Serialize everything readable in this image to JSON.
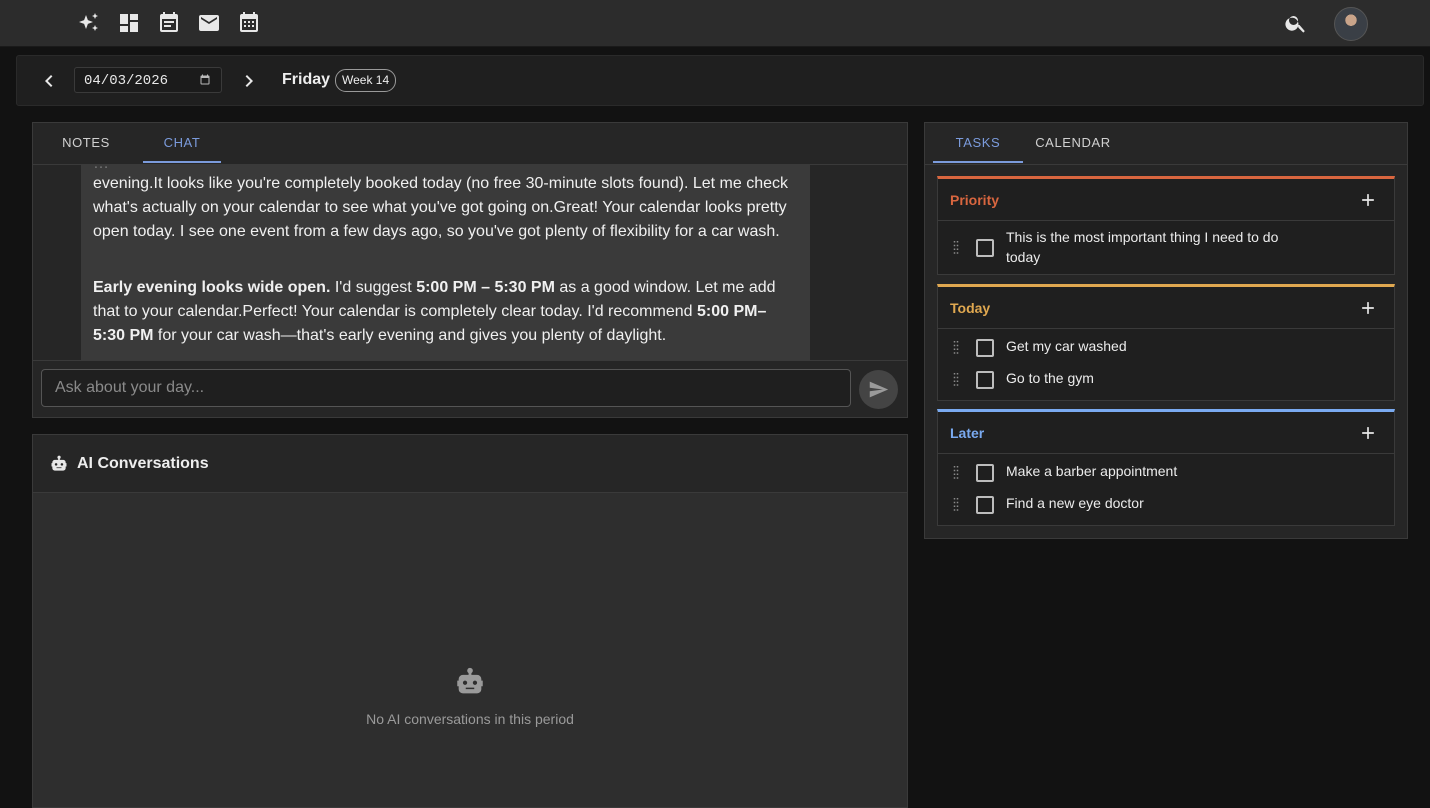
{
  "topbar": {
    "icons": [
      "sparkle-icon",
      "dashboard-icon",
      "event-note-icon",
      "mail-icon",
      "calendar-icon",
      "search-icon"
    ]
  },
  "datebar": {
    "date_value": "04/03/2026",
    "day_name": "Friday",
    "week_badge": "Week 14"
  },
  "chat": {
    "tabs": [
      {
        "label": "NOTES",
        "active": false
      },
      {
        "label": "CHAT",
        "active": true
      }
    ],
    "message": {
      "line_partial": "…",
      "para1": "evening.It looks like you're completely booked today (no free 30-minute slots found). Let me check what's actually on your calendar to see what you've got going on.Great! Your calendar looks pretty open today. I see one event from a few days ago, so you've got plenty of flexibility for a car wash.",
      "para2_bold1": "Early evening looks wide open.",
      "para2_text1": " I'd suggest ",
      "para2_bold2": "5:00 PM – 5:30 PM",
      "para2_text2": " as a good window. Let me add that to your calendar.Perfect! Your calendar is completely clear today. I'd recommend ",
      "para2_bold3": "5:00 PM–5:30 PM",
      "para2_text3": " for your car wash—that's early evening and gives you plenty of daylight."
    },
    "input_placeholder": "Ask about your day..."
  },
  "ai_conversations": {
    "title": "AI Conversations",
    "empty_text": "No AI conversations in this period"
  },
  "tasks": {
    "tabs": [
      {
        "label": "TASKS",
        "active": true
      },
      {
        "label": "CALENDAR",
        "active": false
      }
    ],
    "sections": [
      {
        "title": "Priority",
        "color": "#d9663f",
        "items": [
          "This is the most important thing I need to do today"
        ]
      },
      {
        "title": "Today",
        "color": "#e0a850",
        "items": [
          "Get my car washed",
          "Go to the gym"
        ]
      },
      {
        "title": "Later",
        "color": "#7aaaf0",
        "items": [
          "Make a barber appointment",
          "Find a new eye doctor"
        ]
      }
    ]
  },
  "colors": {
    "accent": "#7b9bdc",
    "priority": "#d9663f",
    "today": "#e0a850",
    "later": "#7aaaf0"
  }
}
